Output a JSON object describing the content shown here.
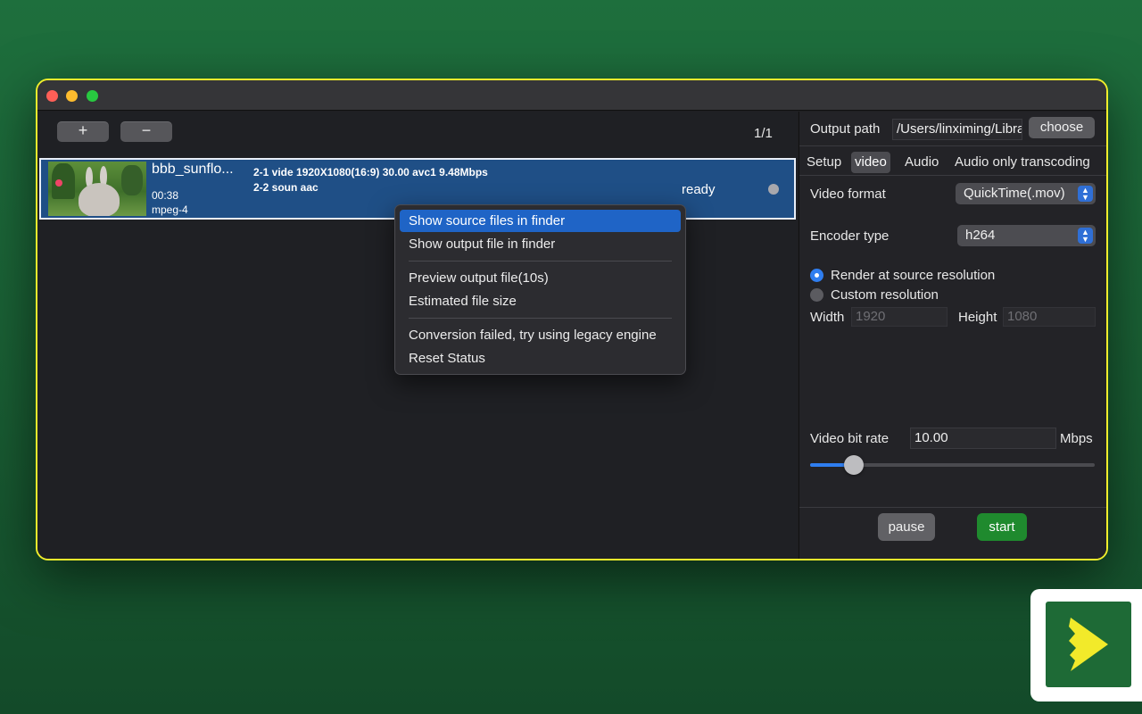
{
  "toolbar": {
    "add_label": "+",
    "remove_label": "−",
    "counter": "1/1"
  },
  "file": {
    "name": "bbb_sunflo...",
    "duration": "00:38",
    "container": "mpeg-4",
    "stream1": "2-1 vide 1920X1080(16:9) 30.00 avc1 9.48Mbps",
    "stream2": "2-2 soun aac",
    "status": "ready"
  },
  "context_menu": {
    "show_source": "Show source files in finder",
    "show_output": "Show output file in finder",
    "preview": "Preview output file(10s)",
    "estimated": "Estimated file size",
    "legacy": "Conversion failed, try using legacy engine",
    "reset": "Reset Status"
  },
  "settings": {
    "output_path_label": "Output path",
    "output_path_value": "/Users/linximing/Library",
    "choose_label": "choose",
    "tabs": [
      "Setup",
      "video",
      "Audio",
      "Audio only transcoding"
    ],
    "active_tab": "video",
    "video_format_label": "Video format",
    "video_format_value": "QuickTime(.mov)",
    "encoder_type_label": "Encoder type",
    "encoder_type_value": "h264",
    "render_source_label": "Render at source resolution",
    "custom_res_label": "Custom resolution",
    "width_label": "Width",
    "width_value": "1920",
    "height_label": "Height",
    "height_value": "1080",
    "bitrate_label": "Video bit rate",
    "bitrate_value": "10.00",
    "bitrate_unit": "Mbps",
    "bitrate_slider_fraction": 0.13
  },
  "actions": {
    "pause_label": "pause",
    "start_label": "start"
  },
  "colors": {
    "accent": "#2f7ef0",
    "selection": "#1f4f86",
    "start_green": "#1f8a2e",
    "window_border": "#f0ee2c"
  }
}
